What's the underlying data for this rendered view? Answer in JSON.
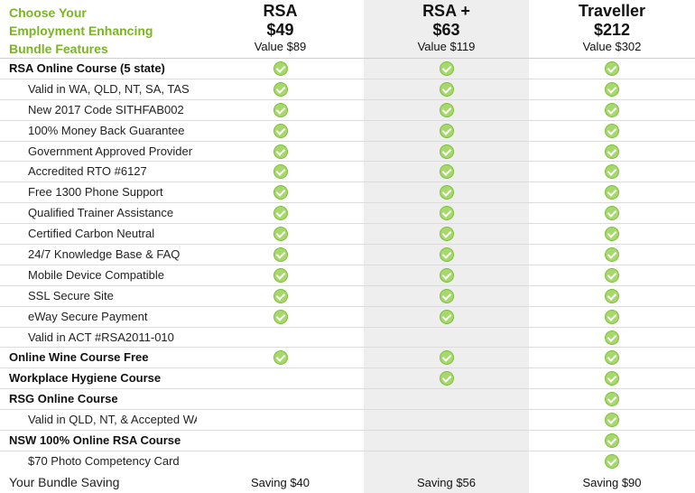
{
  "header": {
    "feature_title_lines": [
      "Choose Your",
      "Employment Enhancing",
      "Bundle Features"
    ],
    "plans": [
      {
        "name": "RSA",
        "price": "$49",
        "value": "Value $89"
      },
      {
        "name": "RSA +",
        "price": "$63",
        "value": "Value $119"
      },
      {
        "name": "Traveller",
        "price": "$212",
        "value": "Value $302"
      }
    ]
  },
  "rows": [
    {
      "label": "RSA Online Course (5 state)",
      "style": "bold",
      "checks": [
        true,
        true,
        true
      ]
    },
    {
      "label": "Valid in WA, QLD, NT, SA, TAS",
      "style": "sub",
      "checks": [
        true,
        true,
        true
      ]
    },
    {
      "label": "New 2017 Code SITHFAB002",
      "style": "sub",
      "checks": [
        true,
        true,
        true
      ]
    },
    {
      "label": "100% Money Back Guarantee",
      "style": "sub",
      "checks": [
        true,
        true,
        true
      ]
    },
    {
      "label": "Government Approved Provider",
      "style": "sub",
      "checks": [
        true,
        true,
        true
      ]
    },
    {
      "label": "Accredited RTO #6127",
      "style": "sub",
      "checks": [
        true,
        true,
        true
      ]
    },
    {
      "label": "Free 1300 Phone Support",
      "style": "sub",
      "checks": [
        true,
        true,
        true
      ]
    },
    {
      "label": "Qualified Trainer Assistance",
      "style": "sub",
      "checks": [
        true,
        true,
        true
      ]
    },
    {
      "label": "Certified Carbon Neutral",
      "style": "sub",
      "checks": [
        true,
        true,
        true
      ]
    },
    {
      "label": "24/7 Knowledge Base & FAQ",
      "style": "sub",
      "checks": [
        true,
        true,
        true
      ]
    },
    {
      "label": "Mobile Device Compatible",
      "style": "sub",
      "checks": [
        true,
        true,
        true
      ]
    },
    {
      "label": "SSL Secure Site",
      "style": "sub",
      "checks": [
        true,
        true,
        true
      ]
    },
    {
      "label": "eWay Secure Payment",
      "style": "sub",
      "checks": [
        true,
        true,
        true
      ]
    },
    {
      "label": "Valid in ACT #RSA2011-010",
      "style": "sub",
      "checks": [
        false,
        false,
        true
      ]
    },
    {
      "label": "Online Wine Course Free",
      "style": "bold",
      "checks": [
        true,
        true,
        true
      ]
    },
    {
      "label": "Workplace Hygiene Course",
      "style": "bold",
      "checks": [
        false,
        true,
        true
      ]
    },
    {
      "label": "RSG Online Course",
      "style": "bold",
      "checks": [
        false,
        false,
        true
      ]
    },
    {
      "label": "Valid in QLD, NT, & Accepted WA",
      "style": "sub",
      "checks": [
        false,
        false,
        true
      ]
    },
    {
      "label": "NSW 100% Online RSA Course",
      "style": "bold",
      "checks": [
        false,
        false,
        true
      ]
    },
    {
      "label": "$70 Photo Competency Card",
      "style": "sub",
      "checks": [
        false,
        false,
        true
      ]
    }
  ],
  "footer": {
    "label": "Your Bundle Saving",
    "savings": [
      "Saving $40",
      "Saving $56",
      "Saving $90"
    ]
  },
  "colors": {
    "title_green": "#7ab522",
    "check_green": "#a6d86b",
    "highlight_column": "#eeeeee"
  }
}
